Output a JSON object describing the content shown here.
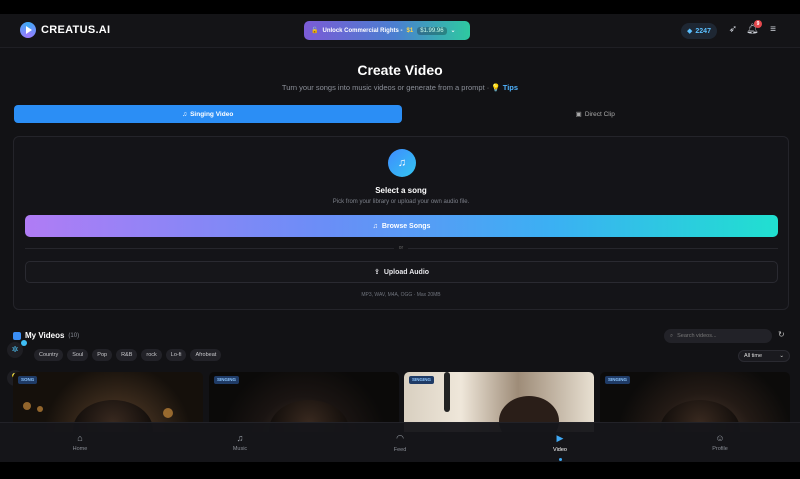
{
  "header": {
    "brand": "CREATUS.AI",
    "promo": {
      "label": "Unlock Commercial Rights -",
      "price_new": "$1",
      "price_old": "$1.99.96",
      "chevron": "⌄"
    },
    "credits": "2247",
    "notifications_count": "9"
  },
  "page": {
    "title": "Create Video",
    "subtitle": "Turn your songs into music videos or generate from a prompt ·",
    "tips": "Tips"
  },
  "tabs": [
    {
      "label": "Singing Video",
      "icon": "music-note-icon",
      "active": true
    },
    {
      "label": "Direct Clip",
      "icon": "clip-icon",
      "active": false
    }
  ],
  "panel": {
    "title": "Select a song",
    "subtitle": "Pick from your library or upload your own audio file.",
    "browse_label": "Browse Songs",
    "or": "or",
    "upload_label": "Upload Audio",
    "formats": "MP3, WAV, M4A, OGG · Max 20MB"
  },
  "videos": {
    "title": "My Videos",
    "count": "(10)",
    "search_placeholder": "Search videos...",
    "filters": [
      "Country",
      "Soul",
      "Pop",
      "R&B",
      "rock",
      "Lo-fi",
      "Afrobeat"
    ],
    "time_filter": "All time",
    "cards": [
      {
        "tag": "SONG"
      },
      {
        "tag": "SINGING"
      },
      {
        "tag": "SINGING"
      },
      {
        "tag": "SINGING"
      }
    ]
  },
  "nav": [
    {
      "label": "Home",
      "icon": "home-icon",
      "active": false
    },
    {
      "label": "Music",
      "icon": "music-icon",
      "active": false
    },
    {
      "label": "Feed",
      "icon": "feed-icon",
      "active": false
    },
    {
      "label": "Video",
      "icon": "video-icon",
      "active": true
    },
    {
      "label": "Profile",
      "icon": "profile-icon",
      "active": false
    }
  ],
  "colors": {
    "accent": "#2b8ef5",
    "background": "#121215",
    "badge": "#e5484d"
  }
}
